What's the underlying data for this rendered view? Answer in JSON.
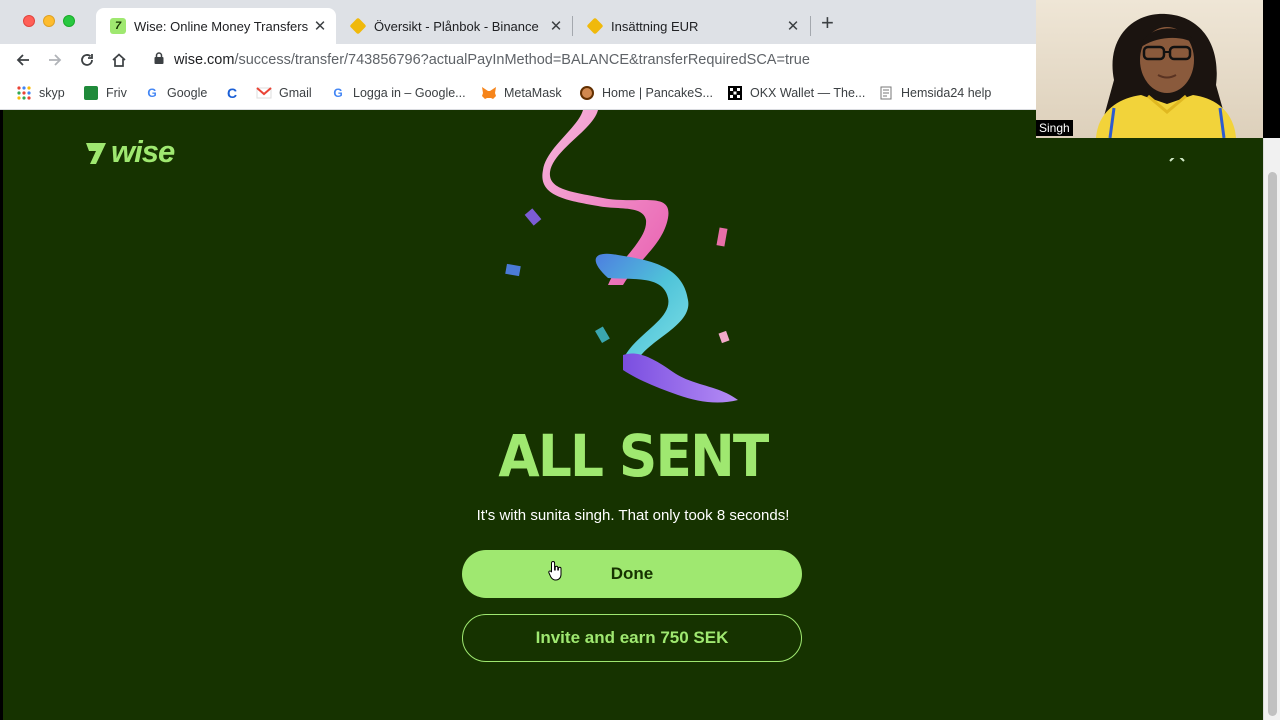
{
  "browser": {
    "tabs": [
      {
        "title": "Wise: Online Money Transfers |",
        "favicon": "wise-icon",
        "active": true
      },
      {
        "title": "Översikt - Plånbok - Binance",
        "favicon": "binance-icon",
        "active": false
      },
      {
        "title": "Insättning EUR",
        "favicon": "binance-icon",
        "active": false
      }
    ],
    "new_tab": "+",
    "url": {
      "host": "wise.com",
      "path": "/success/transfer/743856796?actualPayInMethod=BALANCE&transferRequiredSCA=true"
    },
    "bookmarks": [
      {
        "label": "skyp",
        "icon": "apps-grid-icon"
      },
      {
        "label": "Friv",
        "icon": "friv-icon"
      },
      {
        "label": "Google",
        "icon": "google-icon"
      },
      {
        "label": "",
        "icon": "c-icon"
      },
      {
        "label": "Gmail",
        "icon": "gmail-icon"
      },
      {
        "label": "Logga in – Google...",
        "icon": "google-icon"
      },
      {
        "label": "MetaMask",
        "icon": "metamask-fox-icon"
      },
      {
        "label": "Home | PancakeS...",
        "icon": "pancakeswap-icon"
      },
      {
        "label": "OKX Wallet — The...",
        "icon": "okx-icon"
      },
      {
        "label": "Hemsida24 help",
        "icon": "page-icon"
      }
    ]
  },
  "page": {
    "logo_text": "wise",
    "headline": "ALL SENT",
    "message": "It's with sunita singh. That only took 8 seconds!",
    "done_label": "Done",
    "invite_label": "Invite and earn 750 SEK"
  },
  "webcam": {
    "name": "Singh"
  },
  "colors": {
    "brand_forest": "#163300",
    "brand_lime": "#9fe870"
  }
}
